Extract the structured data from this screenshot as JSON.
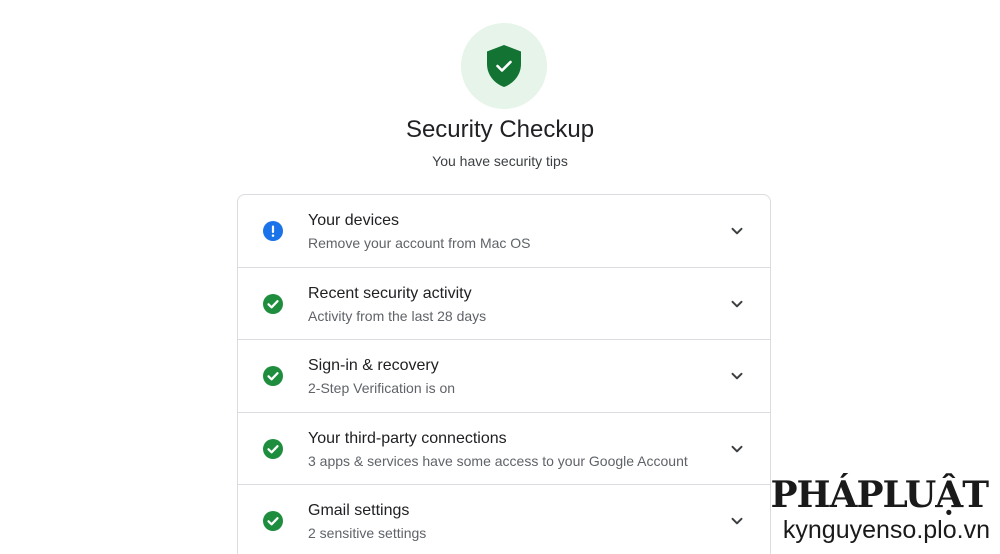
{
  "header": {
    "title": "Security Checkup",
    "subtitle": "You have security tips"
  },
  "colors": {
    "accent_green": "#1e8e3e",
    "shield_green": "#137333",
    "hero_background": "#e6f4ea",
    "info_blue": "#1a73e8",
    "divider": "#dadce0"
  },
  "items": [
    {
      "title": "Your devices",
      "subtitle": "Remove your account from Mac OS",
      "status_icon": "info-icon"
    },
    {
      "title": "Recent security activity",
      "subtitle": "Activity from the last 28 days",
      "status_icon": "check-circle-icon"
    },
    {
      "title": "Sign-in & recovery",
      "subtitle": "2-Step Verification is on",
      "status_icon": "check-circle-icon"
    },
    {
      "title": "Your third-party connections",
      "subtitle": "3 apps & services have some access to your Google Account",
      "status_icon": "check-circle-icon"
    },
    {
      "title": "Gmail settings",
      "subtitle": "2 sensitive settings",
      "status_icon": "check-circle-icon"
    }
  ],
  "watermark": {
    "brand": "PHÁPLUẬT",
    "site": "kynguyenso.plo.vn"
  }
}
